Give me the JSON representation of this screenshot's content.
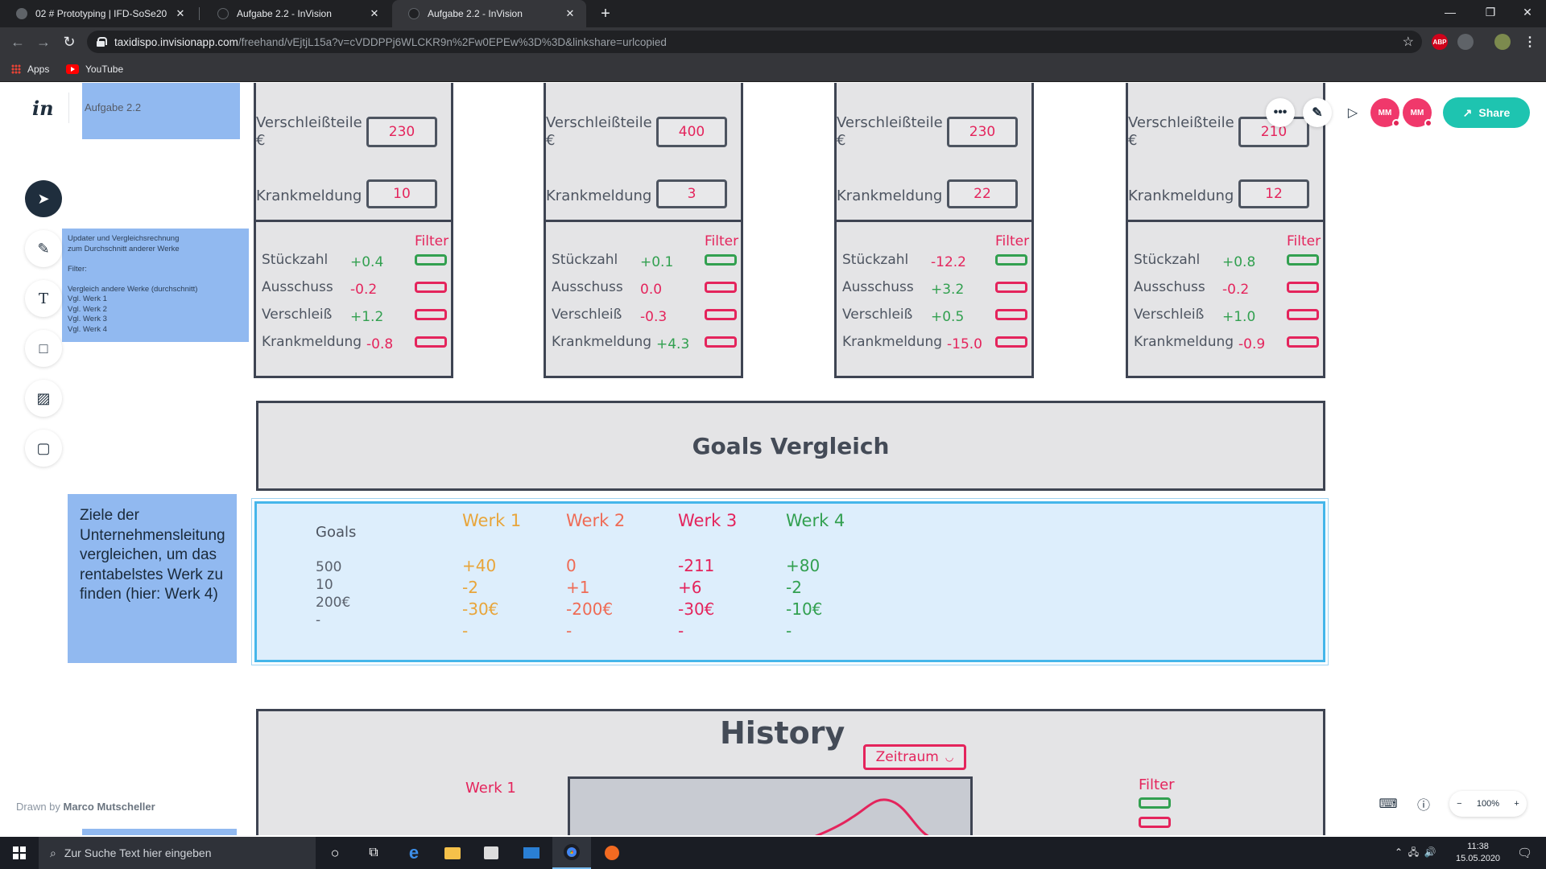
{
  "browser": {
    "tabs": [
      {
        "title": "02 # Prototyping | IFD-SoSe20",
        "active": false
      },
      {
        "title": "Aufgabe 2.2 - InVision",
        "active": false
      },
      {
        "title": "Aufgabe 2.2 - InVision",
        "active": true
      }
    ],
    "url_host": "taxidispo.invisionapp.com",
    "url_path": "/freehand/vEjtjL15a?v=cVDDPPj6WLCKR9n%2Fw0EPEw%3D%3D&linkshare=urlcopied",
    "bookmarks": [
      "Apps",
      "YouTube"
    ],
    "ext_abp": "ABP"
  },
  "invision": {
    "logo": "in",
    "doc_title": "Aufgabe 2.2",
    "tools": [
      "select-tool",
      "pen-tool",
      "text-tool",
      "shape-tool",
      "image-tool",
      "sticky-tool"
    ],
    "drawn_by_prefix": "Drawn by",
    "drawn_by_name": "Marco Mutscheller",
    "avatars": [
      "MM",
      "MM"
    ],
    "share_label": "Share",
    "zoom": "100%"
  },
  "sticky_notes": {
    "filter_note": "Updater und Vergleichsrechnung\nzum Durchschnitt anderer Werke\n\nFilter:\n\nVergleich andere Werke (durchschnitt)\nVgl. Werk 1\nVgl. Werk 2\nVgl. Werk 3\nVgl. Werk 4",
    "goals_note": "Ziele der Unternehmensleitung vergleichen, um das rentabelstes Werk zu finden (hier: Werk 4)"
  },
  "werk_panels": [
    {
      "verschleiss_label": "Verschleißteile\n€",
      "verschleiss_value": "230",
      "krank_label": "Krankmeldung",
      "krank_value": "10",
      "filter": "Filter",
      "rows": [
        {
          "label": "Stückzahl",
          "value": "+0.4",
          "tone": "green"
        },
        {
          "label": "Ausschuss",
          "value": "-0.2",
          "tone": "pink"
        },
        {
          "label": "Verschleiß",
          "value": "+1.2",
          "tone": "green"
        },
        {
          "label": "Krankmeldung",
          "value": "-0.8",
          "tone": "pink"
        }
      ]
    },
    {
      "verschleiss_label": "Verschleißteile\n€",
      "verschleiss_value": "400",
      "krank_label": "Krankmeldung",
      "krank_value": "3",
      "filter": "Filter",
      "rows": [
        {
          "label": "Stückzahl",
          "value": "+0.1",
          "tone": "green"
        },
        {
          "label": "Ausschuss",
          "value": "0.0",
          "tone": "pink"
        },
        {
          "label": "Verschleiß",
          "value": "-0.3",
          "tone": "pink"
        },
        {
          "label": "Krankmeldung",
          "value": "+4.3",
          "tone": "green"
        }
      ]
    },
    {
      "verschleiss_label": "Verschleißteile\n€",
      "verschleiss_value": "230",
      "krank_label": "Krankmeldung",
      "krank_value": "22",
      "filter": "Filter",
      "rows": [
        {
          "label": "Stückzahl",
          "value": "-12.2",
          "tone": "pink"
        },
        {
          "label": "Ausschuss",
          "value": "+3.2",
          "tone": "green"
        },
        {
          "label": "Verschleiß",
          "value": "+0.5",
          "tone": "green"
        },
        {
          "label": "Krankmeldung",
          "value": "-15.0",
          "tone": "pink"
        }
      ]
    },
    {
      "verschleiss_label": "Verschleißteile\n€",
      "verschleiss_value": "210",
      "krank_label": "Krankmeldung",
      "krank_value": "12",
      "filter": "Filter",
      "rows": [
        {
          "label": "Stückzahl",
          "value": "+0.8",
          "tone": "green"
        },
        {
          "label": "Ausschuss",
          "value": "-0.2",
          "tone": "pink"
        },
        {
          "label": "Verschleiß",
          "value": "+1.0",
          "tone": "green"
        },
        {
          "label": "Krankmeldung",
          "value": "-0.9",
          "tone": "pink"
        }
      ]
    }
  ],
  "goals_vergleich": {
    "title": "Goals Vergleich",
    "goals_header": "Goals",
    "goals_values": [
      "500",
      "10",
      "200€",
      "-"
    ],
    "werke": [
      {
        "name": "Werk 1",
        "tone": "orange",
        "values": [
          "+40",
          "-2",
          "-30€",
          "-"
        ]
      },
      {
        "name": "Werk 2",
        "tone": "salmon",
        "values": [
          "0",
          "+1",
          "-200€",
          "-"
        ]
      },
      {
        "name": "Werk 3",
        "tone": "pink",
        "values": [
          "-211",
          "+6",
          "-30€",
          "-"
        ]
      },
      {
        "name": "Werk 4",
        "tone": "green",
        "values": [
          "+80",
          "-2",
          "-10€",
          "-"
        ]
      }
    ]
  },
  "history": {
    "title": "History",
    "zeitraum": "Zeitraum",
    "werk_label": "Werk 1",
    "filter": "Filter"
  },
  "taskbar": {
    "search_placeholder": "Zur Suche Text hier eingeben",
    "time": "11:38",
    "date": "15.05.2020"
  },
  "colors": {
    "accent_pink": "#e4245c",
    "accent_green": "#32a050",
    "accent_orange": "#e8a53a",
    "share_teal": "#1ec4b0",
    "sticky_blue": "#91b9f0",
    "goals_blue": "#45b6ea"
  }
}
